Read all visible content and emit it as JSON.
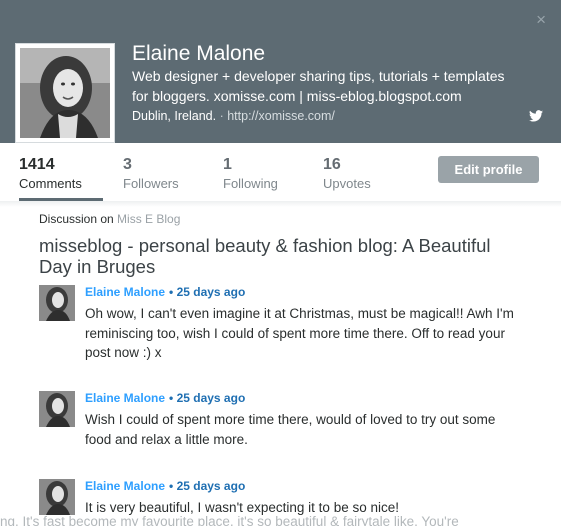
{
  "profile": {
    "name": "Elaine Malone",
    "bio": "Web designer + developer sharing tips, tutorials + templates for bloggers. xomisse.com | miss-eblog.blogspot.com",
    "location": "Dublin, Ireland.",
    "separator": "·",
    "website": "http://xomisse.com/",
    "close_label": "×"
  },
  "stats": {
    "comments": {
      "value": "1414",
      "label": "Comments"
    },
    "followers": {
      "value": "3",
      "label": "Followers"
    },
    "following": {
      "value": "1",
      "label": "Following"
    },
    "upvotes": {
      "value": "16",
      "label": "Upvotes"
    }
  },
  "edit_button": "Edit profile",
  "discussion": {
    "prefix": "Discussion on",
    "forum": "Miss E Blog",
    "thread_title": "misseblog - personal beauty & fashion blog: A Beautiful Day in Bruges"
  },
  "comments": [
    {
      "author": "Elaine Malone",
      "time": "• 25 days ago",
      "text": "Oh wow, I can't even imagine it at Christmas, must be magical!! Awh I'm reminiscing too, wish I could of spent more time there. Off to read your post now :) x"
    },
    {
      "author": "Elaine Malone",
      "time": "• 25 days ago",
      "text": "Wish I could of spent more time there, would of loved to try out some food and relax a little more."
    },
    {
      "author": "Elaine Malone",
      "time": "• 25 days ago",
      "text": "It is very beautiful, I wasn't expecting it to be so nice!"
    }
  ],
  "background_text": "ng. It's fast become my favourite place, it's so beautiful & fairytale like. You're",
  "colors": {
    "header_bg": "#5d6b73",
    "link_blue": "#2e9fff",
    "button_gray": "#9aa3a8"
  },
  "icons": {
    "close": "close-icon",
    "twitter": "twitter-icon"
  }
}
